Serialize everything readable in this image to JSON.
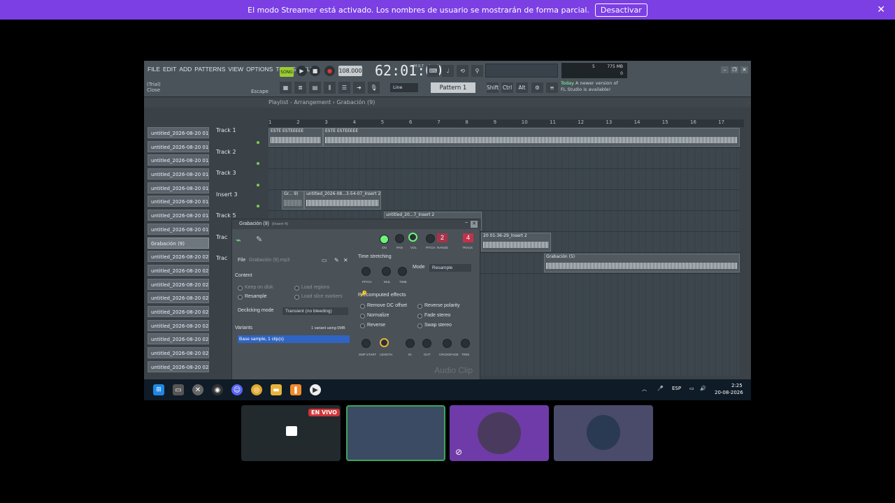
{
  "banner": {
    "text": "El modo Streamer está activado. Los nombres de usuario se mostrarán de forma parcial.",
    "button": "Desactivar",
    "close": "✕"
  },
  "fl": {
    "menu": [
      "FILE",
      "EDIT",
      "ADD",
      "PATTERNS",
      "VIEW",
      "OPTIONS",
      "TOOLS",
      "HELP"
    ],
    "trial_line1": "(Trial)",
    "trial_line2": "Close",
    "escape": "Escape",
    "song": "SONG",
    "tempo": "108.000",
    "time": "62:01:00",
    "time_unit": "M:S:T",
    "mem_value": "775 MB",
    "mem_cpu": "5",
    "mem_zero": "0",
    "line_select": "Line",
    "pattern": "Pattern 1",
    "keys": [
      "Shift",
      "Ctrl",
      "Alt"
    ],
    "news_today": "Today",
    "news_text": "A newer version of",
    "news_text2": "FL Studio is available!"
  },
  "playlist": {
    "title": "Playlist - Arrangement",
    "subtitle": "Grabación (9)",
    "ruler": [
      "1",
      "2",
      "3",
      "4",
      "5",
      "6",
      "7",
      "8",
      "9",
      "10",
      "11",
      "12",
      "13",
      "14",
      "15",
      "16",
      "17"
    ],
    "tracks": [
      "Track 1",
      "Track 2",
      "Track 3",
      "Insert 3",
      "Track 5",
      "Trac",
      "Trac"
    ],
    "clips": {
      "c1a": "ESTE ESTEEEEE",
      "c1b": "ESTE ESTEEEEE",
      "c4a": "Gr... 9)",
      "c4b": "untitled_2026-08...3-54-07_Insert 2",
      "c5": "untitled_20...7_Insert 2",
      "c6": "20 01-36-29_Insert 2",
      "c7": "Grabación (5)"
    }
  },
  "browser": {
    "items": [
      "untitled_2026-08-20 01-...",
      "untitled_2026-08-20 01-...",
      "untitled_2026-08-20 01-...",
      "untitled_2026-08-20 01-...",
      "untitled_2026-08-20 01-...",
      "untitled_2026-08-20 01-...",
      "untitled_2026-08-20 01-...",
      "untitled_2026-08-20 01-...",
      "Grabación (9)",
      "untitled_2026-08-20 02-...",
      "untitled_2026-08-20 02-...",
      "untitled_2026-08-20 02-...",
      "untitled_2026-08-20 02-...",
      "untitled_2026-08-20 02-...",
      "untitled_2026-08-20 02-...",
      "untitled_2026-08-20 02-...",
      "untitled_2026-08-20 02-...",
      "untitled_2026-08-20 02-..."
    ]
  },
  "dialog": {
    "title": "Grabación (9)",
    "subtitle": "(Insert 4)",
    "knob_labels": [
      "ON",
      "PAN",
      "VOL",
      "PITCH",
      "RANGE",
      "TRACK"
    ],
    "range_value": "2",
    "track_value": "4",
    "file_label": "File",
    "file_name": "Grabación (9).mp3",
    "time_stretching": "Time stretching",
    "ts_knobs": [
      "PITCH",
      "MUL",
      "TIME"
    ],
    "mode_label": "Mode",
    "mode_value": "Resample",
    "content_label": "Content",
    "keep_on_disk": "Keep on disk",
    "load_regions": "Load regions",
    "resample": "Resample",
    "load_slice": "Load slice markers",
    "declicking_label": "Declicking mode",
    "declicking_value": "Transient (no bleeding)",
    "precomputed": "Precomputed effects",
    "effects": [
      "Remove DC offset",
      "Reverse polarity",
      "Normalize",
      "Fade stereo",
      "Reverse",
      "Swap stereo"
    ],
    "variants_label": "Variants",
    "variants_info": "1 variant using 0MB",
    "variant_item": "Base sample, 1 clip(s)",
    "fx_knobs": [
      "SMP START",
      "LENGTH",
      "IN",
      "OUT",
      "CROSSFADE",
      "TRIM"
    ],
    "audio_clip": "Audio Clip"
  },
  "taskbar": {
    "lang": "ESP",
    "time": "2:25",
    "date": "20-08-2026"
  },
  "thumbs": {
    "live": "EN VIVO"
  },
  "colors": {
    "banner": "#7b3fe4",
    "live": "#d13438",
    "thumb_purple": "#6f3ba8"
  }
}
